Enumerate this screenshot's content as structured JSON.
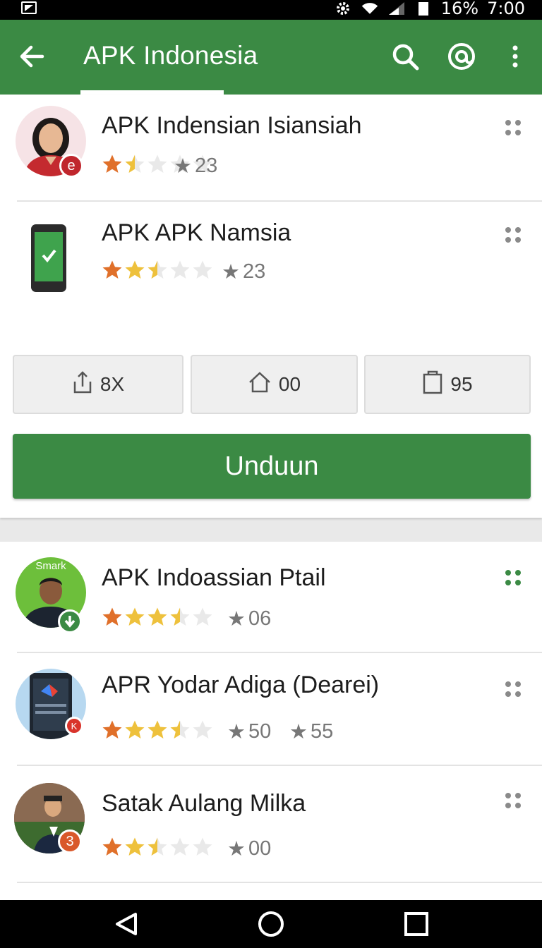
{
  "status_bar": {
    "battery_text": "16%",
    "time": "7:00"
  },
  "app_bar": {
    "title": "APK Indonesia"
  },
  "apps": [
    {
      "name": "APK Indensian Isiansiah",
      "rating": 1.5,
      "meta": [
        "23"
      ],
      "badge": "e"
    },
    {
      "name": "APK APK Namsia",
      "rating": 2.5,
      "meta": [
        "23"
      ]
    },
    {
      "name": "APK Indoassian Ptail",
      "rating": 3.5,
      "meta": [
        "06"
      ],
      "avatar_text": "Smark"
    },
    {
      "name": "APR Yodar Adiga (Dearei)",
      "rating": 3.5,
      "meta": [
        "50",
        "55"
      ],
      "badge": "K"
    },
    {
      "name": "Satak Aulang Milka",
      "rating": 2.5,
      "meta": [
        "00"
      ],
      "badge": "3"
    }
  ],
  "stats": [
    {
      "icon": "share-icon",
      "value": "8X"
    },
    {
      "icon": "house-icon",
      "value": "00"
    },
    {
      "icon": "clipboard-icon",
      "value": "95"
    }
  ],
  "download_label": "Unduun",
  "colors": {
    "primary": "#3b8a44",
    "star_orange": "#e0702a",
    "star_yellow": "#eec13c"
  }
}
